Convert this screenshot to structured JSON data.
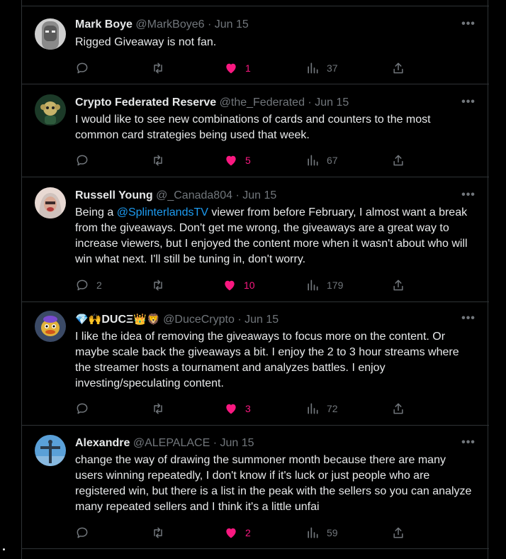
{
  "tweets": [
    {
      "name": "Mark Boye",
      "name_emoji": "",
      "handle": "@MarkBoye6",
      "date": "Jun 15",
      "body_pre": "Rigged Giveaway is not fan.",
      "mention": "",
      "body_post": "",
      "replies": "",
      "likes": "1",
      "views": "37",
      "avatar": "avatar-masked-face",
      "colors": {
        "avatar_bg": "#d9d9d9",
        "avatar_fg": "#4a4a4a"
      }
    },
    {
      "name": "Crypto Federated Reserve",
      "name_emoji": "",
      "handle": "@the_Federated",
      "date": "Jun 15",
      "body_pre": "I would like to see new combinations of cards and counters to the most common card strategies being used that week.",
      "mention": "",
      "body_post": "",
      "replies": "",
      "likes": "5",
      "views": "67",
      "avatar": "avatar-green-monkey",
      "colors": {
        "avatar_bg": "#1f3a2a",
        "avatar_fg": "#c7b36a"
      }
    },
    {
      "name": "Russell Young",
      "name_emoji": "",
      "handle": "@_Canada804",
      "date": "Jun 15",
      "body_pre": "Being a ",
      "mention": "@SplinterlandsTV",
      "body_post": " viewer from before February, I almost want a break from the giveaways. Don't get me wrong, the giveaways are a great way to increase viewers, but I enjoyed the content more when it wasn't about who will win what next. I'll still be tuning in, don't worry.",
      "replies": "2",
      "likes": "10",
      "views": "179",
      "avatar": "avatar-hooded-person",
      "colors": {
        "avatar_bg": "#e6d5cf",
        "avatar_fg": "#b13a3a"
      }
    },
    {
      "name": "DUCΞ",
      "name_emoji_pre": "💎🙌",
      "name_emoji": "👑🦁",
      "handle": "@DuceCrypto",
      "date": "Jun 15",
      "body_pre": "I like the idea of removing the giveaways to focus more on the content. Or maybe scale back the giveaways a bit. I enjoy the 2 to 3 hour streams where the streamer hosts a tournament and analyzes battles. I enjoy investing/speculating content.",
      "mention": "",
      "body_post": "",
      "replies": "",
      "likes": "3",
      "views": "72",
      "avatar": "avatar-cartoon-duck",
      "colors": {
        "avatar_bg": "#3b4a66",
        "avatar_fg": "#e0b13a"
      }
    },
    {
      "name": "Alexandre",
      "name_emoji": "",
      "handle": "@ALEPALACE",
      "date": "Jun 15",
      "body_pre": "change the way of drawing the summoner month because there are many users winning repeatedly, I don't know if it's luck or just people who are registered win, but there is a list in the peak with the sellers so you can analyze many repeated sellers and I think it's a little unfai",
      "mention": "",
      "body_post": "",
      "replies": "",
      "likes": "2",
      "views": "59",
      "avatar": "avatar-statue-sky",
      "colors": {
        "avatar_bg": "#5aa0d8",
        "avatar_fg": "#2b3a4a"
      }
    }
  ],
  "icons": {
    "more": "more-horizontal-icon",
    "reply": "reply-icon",
    "retweet": "retweet-icon",
    "like": "heart-filled-icon",
    "views": "views-bar-chart-icon",
    "share": "share-icon"
  },
  "colors": {
    "background": "#000000",
    "text": "#e7e9ea",
    "muted": "#71767b",
    "like": "#f91880",
    "link": "#1d9bf0",
    "divider": "#2f3336"
  },
  "ui": {
    "more_label": "•••",
    "separator": "·"
  }
}
